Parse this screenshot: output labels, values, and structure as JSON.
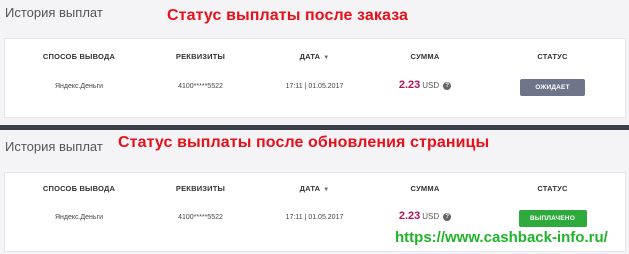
{
  "panel_before": {
    "title": "История выплат",
    "annotation": "Статус выплаты после заказа",
    "headers": {
      "method": "СПОСОБ ВЫВОДА",
      "requisites": "РЕКВИЗИТЫ",
      "date": "ДАТА",
      "date_sort_icon": "caret-down",
      "sum": "СУММА",
      "status": "СТАТУС"
    },
    "row": {
      "method": "Яндекс.Деньги",
      "requisites": "4100*****5522",
      "date": "17:11 | 01.05.2017",
      "amount": "2.23",
      "currency": "USD",
      "help_icon": "?",
      "status": "ОЖИДАЕТ",
      "status_color": "#6f7488"
    }
  },
  "panel_after": {
    "title": "История выплат",
    "annotation": "Статус выплаты после обновления страницы",
    "headers": {
      "method": "СПОСОБ ВЫВОДА",
      "requisites": "РЕКВИЗИТЫ",
      "date": "ДАТА",
      "date_sort_icon": "caret-down",
      "sum": "СУММА",
      "status": "СТАТУС"
    },
    "row": {
      "method": "Яндекс.Деньги",
      "requisites": "4100*****5522",
      "date": "17:11 | 01.05.2017",
      "amount": "2.23",
      "currency": "USD",
      "help_icon": "?",
      "status": "ВЫПЛАЧЕНО",
      "status_color": "#2eaa3c"
    }
  },
  "source_link": "https://www.cashback-info.ru/",
  "colors": {
    "annotation": "#e8101a",
    "amount": "#b0145a",
    "link": "#1fb42a"
  }
}
